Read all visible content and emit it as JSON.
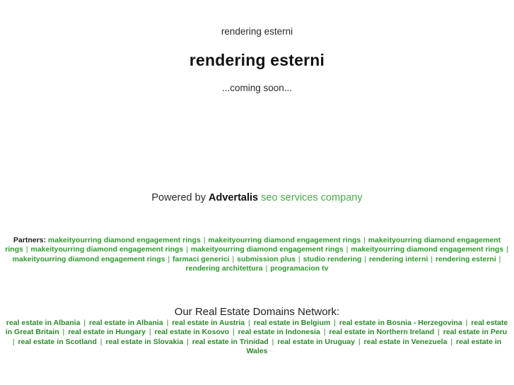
{
  "header": {
    "site_name": "rendering esterni",
    "main_title": "rendering esterni",
    "coming_soon": "...coming soon..."
  },
  "powered_by": {
    "prefix": "Powered by ",
    "brand": "Advertalis",
    "tagline": " seo services company",
    "brand_color": "#111111",
    "tagline_color": "#4aaa4a"
  },
  "partners": {
    "label": "Partners:",
    "separator": "|",
    "link_color": "#2f9a2f",
    "items": [
      "makeityourring diamond engagement rings",
      "makeityourring diamond engagement rings",
      "makeityourring diamond engagement rings",
      "makeityourring diamond engagement rings",
      "makeityourring diamond engagement rings",
      "makeityourring diamond engagement rings",
      "makeityourring diamond engagement rings",
      "farmaci generici",
      "submission plus",
      "studio rendering",
      "rendering interni",
      "rendering esterni",
      "rendering architettura",
      "programacion tv"
    ]
  },
  "network": {
    "title": "Our Real Estate Domains Network:",
    "separator": "|",
    "link_color": "#2a8a2a",
    "items": [
      "real estate in Albania",
      "real estate in Albania",
      "real estate in Austria",
      "real estate in Belgium",
      "real estate in Bosnia - Herzegovina",
      "real estate in Great Britain",
      "real estate in Hungary",
      "real estate in Kosovo",
      "real estate in Indonesia",
      "real estate in Northern Ireland",
      "real estate in Peru",
      "real estate in Scotland",
      "real estate in Slovakia",
      "real estate in Trinidad",
      "real estate in Uruguay",
      "real estate in Venezuela",
      "real estate in Wales"
    ]
  }
}
